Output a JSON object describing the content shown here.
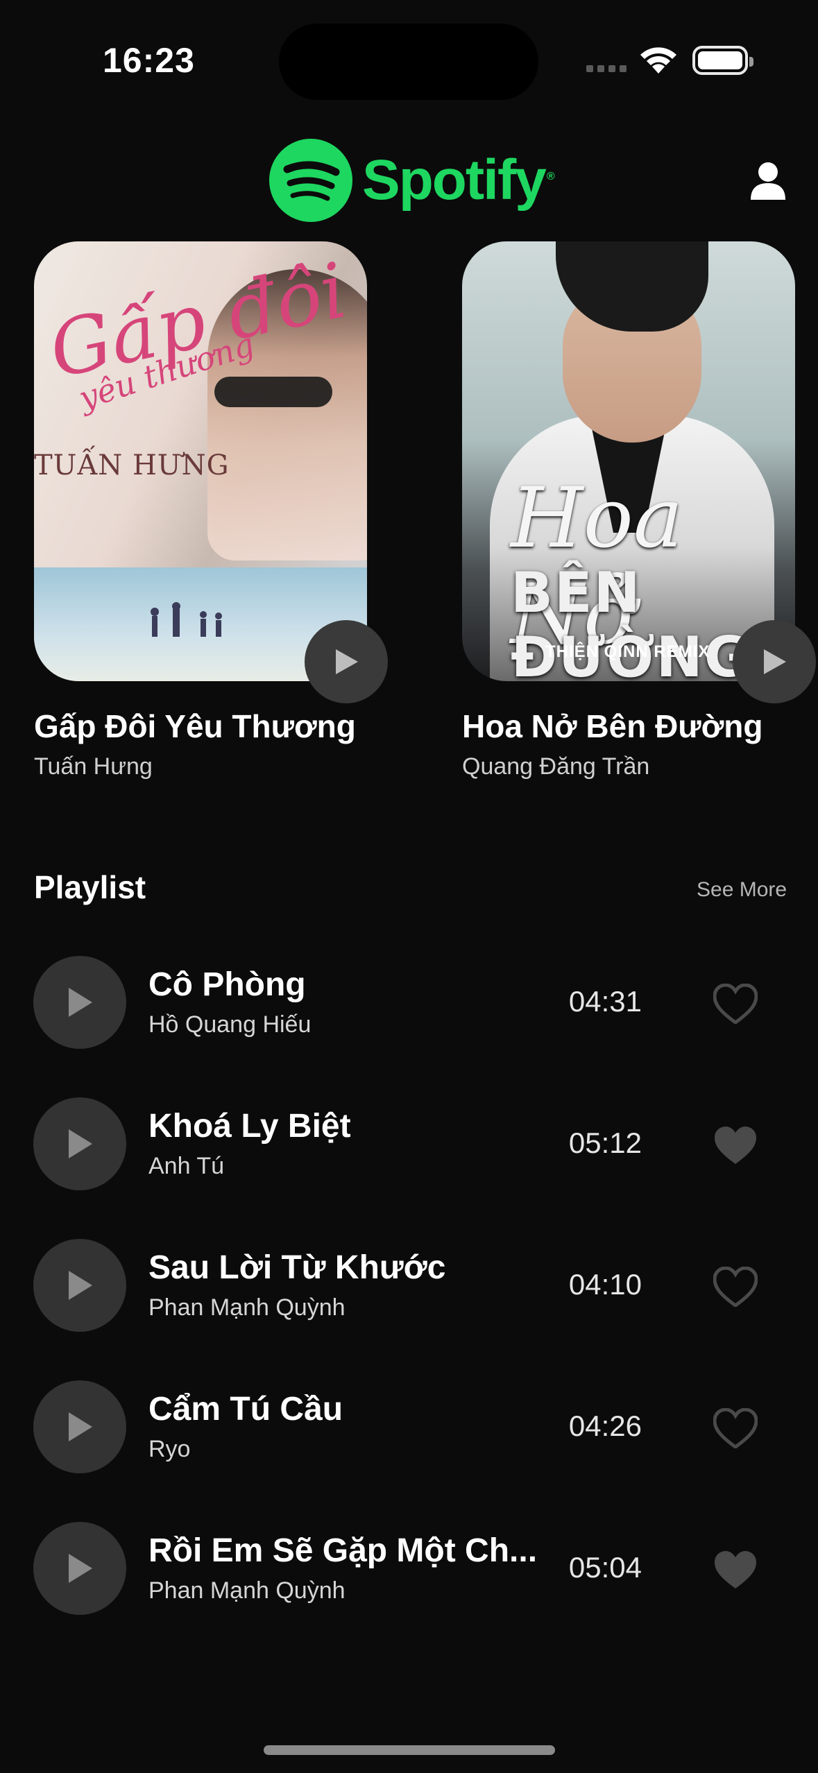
{
  "status_bar": {
    "time": "16:23"
  },
  "header": {
    "brand": "Spotify",
    "trademark": "®"
  },
  "featured": [
    {
      "title": "Gấp Đôi Yêu Thương",
      "artist": "Tuấn Hưng",
      "cover_text": [
        "Gấp đôi",
        "yêu thương",
        "TUẤN HƯNG"
      ]
    },
    {
      "title": "Hoa Nở Bên Đường",
      "artist": "Quang Đăng Trần",
      "cover_text": [
        "Hoa Nở",
        "BÊN ĐƯỜNG",
        "THIỆN QINN REMIX"
      ]
    }
  ],
  "playlist": {
    "title": "Playlist",
    "see_more": "See More",
    "items": [
      {
        "name": "Cô Phòng",
        "artist": "Hồ Quang Hiếu",
        "duration": "04:31",
        "liked": false
      },
      {
        "name": "Khoá Ly Biệt",
        "artist": "Anh Tú",
        "duration": "05:12",
        "liked": true
      },
      {
        "name": "Sau Lời Từ Khước",
        "artist": "Phan Mạnh Quỳnh",
        "duration": "04:10",
        "liked": false
      },
      {
        "name": "Cẩm Tú Cầu",
        "artist": "Ryo",
        "duration": "04:26",
        "liked": false
      },
      {
        "name": "Rồi Em Sẽ Gặp Một Ch...",
        "artist": "Phan Mạnh Quỳnh",
        "duration": "05:04",
        "liked": true
      }
    ]
  },
  "colors": {
    "background": "#0b0b0b",
    "brand": "#1ed760",
    "button": "#333333",
    "heart": "#4a4a4a"
  },
  "icons": [
    "spotify-logo-icon",
    "profile-icon",
    "play-icon",
    "heart-outline-icon",
    "heart-filled-icon",
    "wifi-icon",
    "battery-icon",
    "signal-icon"
  ]
}
